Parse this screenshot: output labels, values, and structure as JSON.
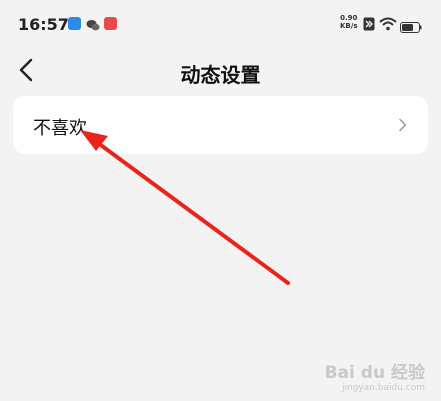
{
  "status_bar": {
    "time": "16:57",
    "net_speed_value": "0.90",
    "net_speed_unit": "KB/s"
  },
  "nav": {
    "title": "动态设置"
  },
  "settings": {
    "items": [
      {
        "label": "不喜欢"
      }
    ]
  },
  "watermark": {
    "brand": "Bai du 经验",
    "url": "jingyan.baidu.com"
  },
  "colors": {
    "background": "#f3f3f3",
    "card": "#ffffff",
    "annotation_arrow": "#e8241c"
  }
}
